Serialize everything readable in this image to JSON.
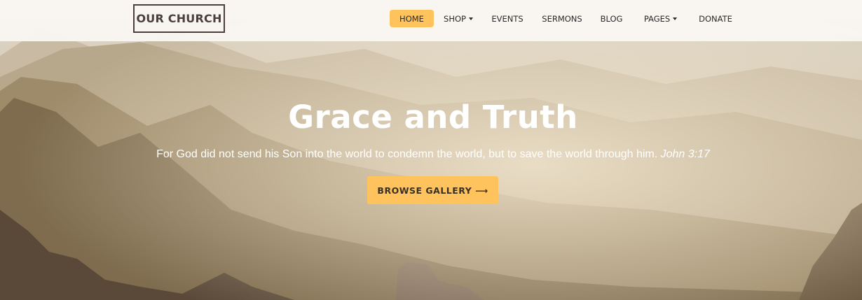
{
  "brand": {
    "logo_text": "OUR CHURCH"
  },
  "nav": {
    "items": [
      {
        "label": "HOME",
        "active": true,
        "dropdown": false
      },
      {
        "label": "SHOP",
        "active": false,
        "dropdown": true
      },
      {
        "label": "EVENTS",
        "active": false,
        "dropdown": false
      },
      {
        "label": "SERMONS",
        "active": false,
        "dropdown": false
      },
      {
        "label": "BLOG",
        "active": false,
        "dropdown": false
      },
      {
        "label": "PAGES",
        "active": false,
        "dropdown": true
      },
      {
        "label": "DONATE",
        "active": false,
        "dropdown": false
      }
    ]
  },
  "hero": {
    "title": "Grace and Truth",
    "verse": "For God did not send his Son into the world to condemn the world, but to save the world through him.",
    "reference": "John 3:17",
    "button_label": "BROWSE GALLERY ⟶"
  },
  "colors": {
    "accent": "#fec35c",
    "logo": "#4a4039",
    "nav_text": "#2a2a2a"
  },
  "icons": {
    "dropdown": "caret-down-icon"
  }
}
